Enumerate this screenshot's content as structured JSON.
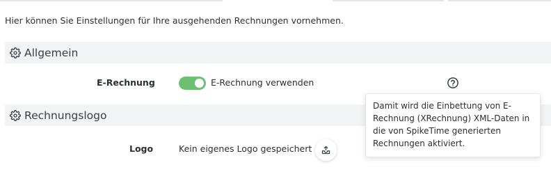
{
  "intro_text": "Hier können Sie Einstellungen für Ihre ausgehenden Rechnungen vornehmen.",
  "sections": {
    "general": {
      "title": "Allgemein",
      "icon": "gear-icon",
      "e_invoice": {
        "label": "E-Rechnung",
        "toggle_on": true,
        "toggle_label": "E-Rechnung verwenden",
        "toggle_color": "#6cc070",
        "help_icon": "question-circle-icon",
        "tooltip_lines": [
          "Damit wird die Einbettung von E-",
          "Rechnung (XRechnung) XML-Daten in",
          "die von SpikeTime generierten",
          "Rechnungen aktiviert."
        ]
      }
    },
    "invoice_logo": {
      "title": "Rechnungslogo",
      "icon": "gear-icon",
      "logo": {
        "label": "Logo",
        "status": "Kein eigenes Logo gespeichert",
        "upload_icon": "upload-icon"
      }
    }
  }
}
